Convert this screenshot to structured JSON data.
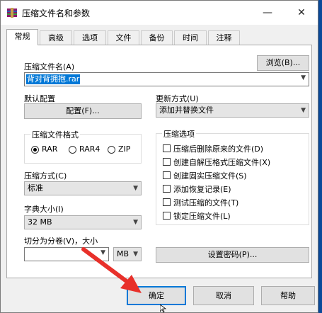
{
  "window": {
    "title": "压缩文件名和参数"
  },
  "titlebar": {
    "minimize": "—",
    "close": "✕"
  },
  "tabs": [
    "常规",
    "高级",
    "选项",
    "文件",
    "备份",
    "时间",
    "注释"
  ],
  "general": {
    "archive_name_label": "压缩文件名(A)",
    "browse_button": "浏览(B)...",
    "archive_name_value": "背对背拥抱.rar",
    "default_profile_label": "默认配置",
    "profile_button": "配置(F)...",
    "update_mode_label": "更新方式(U)",
    "update_mode_value": "添加并替换文件",
    "format_group_title": "压缩文件格式",
    "formats": [
      "RAR",
      "RAR4",
      "ZIP"
    ],
    "selected_format": "RAR",
    "method_label": "压缩方式(C)",
    "method_value": "标准",
    "dict_label": "字典大小(I)",
    "dict_value": "32 MB",
    "split_label": "切分为分卷(V)，大小",
    "split_unit": "MB",
    "options_group_title": "压缩选项",
    "options": [
      "压缩后删除原来的文件(D)",
      "创建自解压格式压缩文件(X)",
      "创建固实压缩文件(S)",
      "添加恢复记录(E)",
      "测试压缩的文件(T)",
      "锁定压缩文件(L)"
    ],
    "password_button": "设置密码(P)..."
  },
  "buttons": {
    "ok": "确定",
    "cancel": "取消",
    "help": "帮助"
  },
  "colors": {
    "accent": "#0078d7",
    "annotation": "#e8302a"
  }
}
